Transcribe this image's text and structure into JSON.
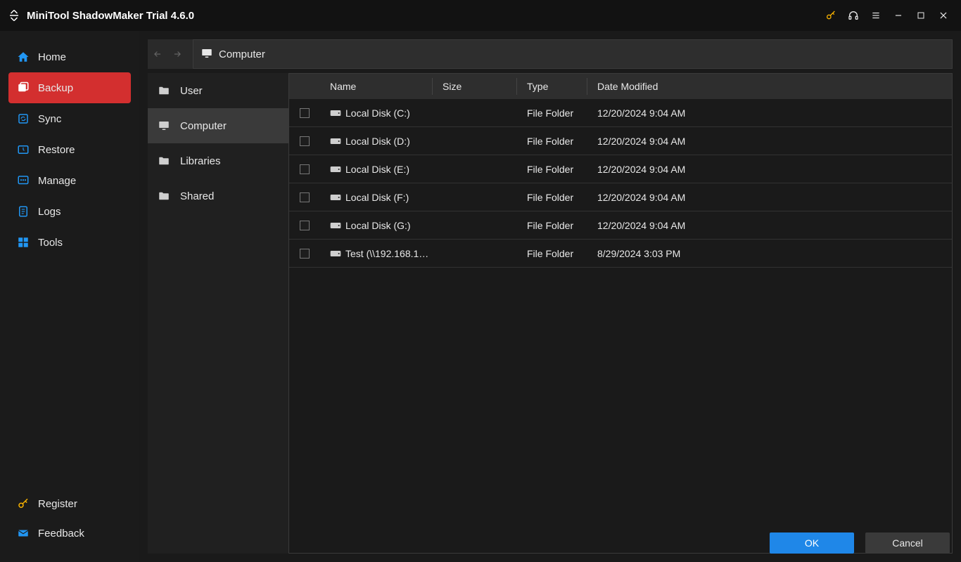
{
  "app": {
    "title": "MiniTool ShadowMaker Trial 4.6.0"
  },
  "sidebar": {
    "items": [
      {
        "label": "Home",
        "active": false,
        "icon": "home"
      },
      {
        "label": "Backup",
        "active": true,
        "icon": "backup"
      },
      {
        "label": "Sync",
        "active": false,
        "icon": "sync"
      },
      {
        "label": "Restore",
        "active": false,
        "icon": "restore"
      },
      {
        "label": "Manage",
        "active": false,
        "icon": "manage"
      },
      {
        "label": "Logs",
        "active": false,
        "icon": "logs"
      },
      {
        "label": "Tools",
        "active": false,
        "icon": "tools"
      }
    ],
    "bottom": [
      {
        "label": "Register",
        "icon": "key"
      },
      {
        "label": "Feedback",
        "icon": "mail"
      }
    ]
  },
  "path": {
    "current": "Computer"
  },
  "tree": [
    {
      "label": "User",
      "icon": "folder",
      "selected": false
    },
    {
      "label": "Computer",
      "icon": "monitor",
      "selected": true
    },
    {
      "label": "Libraries",
      "icon": "folder",
      "selected": false
    },
    {
      "label": "Shared",
      "icon": "folder",
      "selected": false
    }
  ],
  "table": {
    "columns": {
      "name": "Name",
      "size": "Size",
      "type": "Type",
      "date": "Date Modified"
    },
    "rows": [
      {
        "name": "Local Disk (C:)",
        "size": "",
        "type": "File Folder",
        "date": "12/20/2024 9:04 AM"
      },
      {
        "name": "Local Disk (D:)",
        "size": "",
        "type": "File Folder",
        "date": "12/20/2024 9:04 AM"
      },
      {
        "name": "Local Disk (E:)",
        "size": "",
        "type": "File Folder",
        "date": "12/20/2024 9:04 AM"
      },
      {
        "name": "Local Disk (F:)",
        "size": "",
        "type": "File Folder",
        "date": "12/20/2024 9:04 AM"
      },
      {
        "name": "Local Disk (G:)",
        "size": "",
        "type": "File Folder",
        "date": "12/20/2024 9:04 AM"
      },
      {
        "name": "Test (\\\\192.168.1…",
        "size": "",
        "type": "File Folder",
        "date": "8/29/2024 3:03 PM"
      }
    ]
  },
  "footer": {
    "ok": "OK",
    "cancel": "Cancel"
  }
}
